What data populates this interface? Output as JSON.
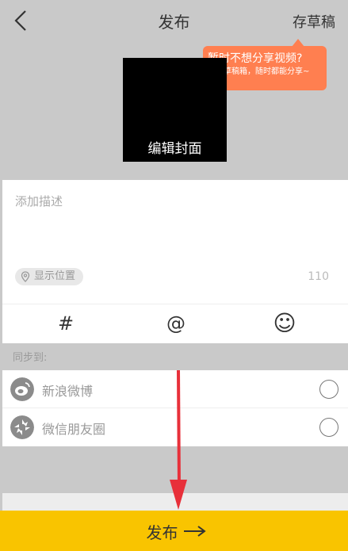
{
  "header": {
    "title": "发布",
    "save_draft_label": "存草稿"
  },
  "tooltip": {
    "title": "暂时不想分享视频?",
    "subtitle": "放进草稿箱，随时都能分享~"
  },
  "cover": {
    "label": "编辑封面"
  },
  "description": {
    "placeholder": "添加描述",
    "location_label": "显示位置",
    "char_count": "110"
  },
  "toolbar": {
    "hashtag_symbol": "#",
    "mention_symbol": "@",
    "emoji_symbol": "☺"
  },
  "sync": {
    "label": "同步到:",
    "items": [
      {
        "label": "新浪微博",
        "icon": "weibo-icon"
      },
      {
        "label": "微信朋友圈",
        "icon": "wechat-moments-icon"
      }
    ]
  },
  "publish": {
    "label": "发布"
  }
}
